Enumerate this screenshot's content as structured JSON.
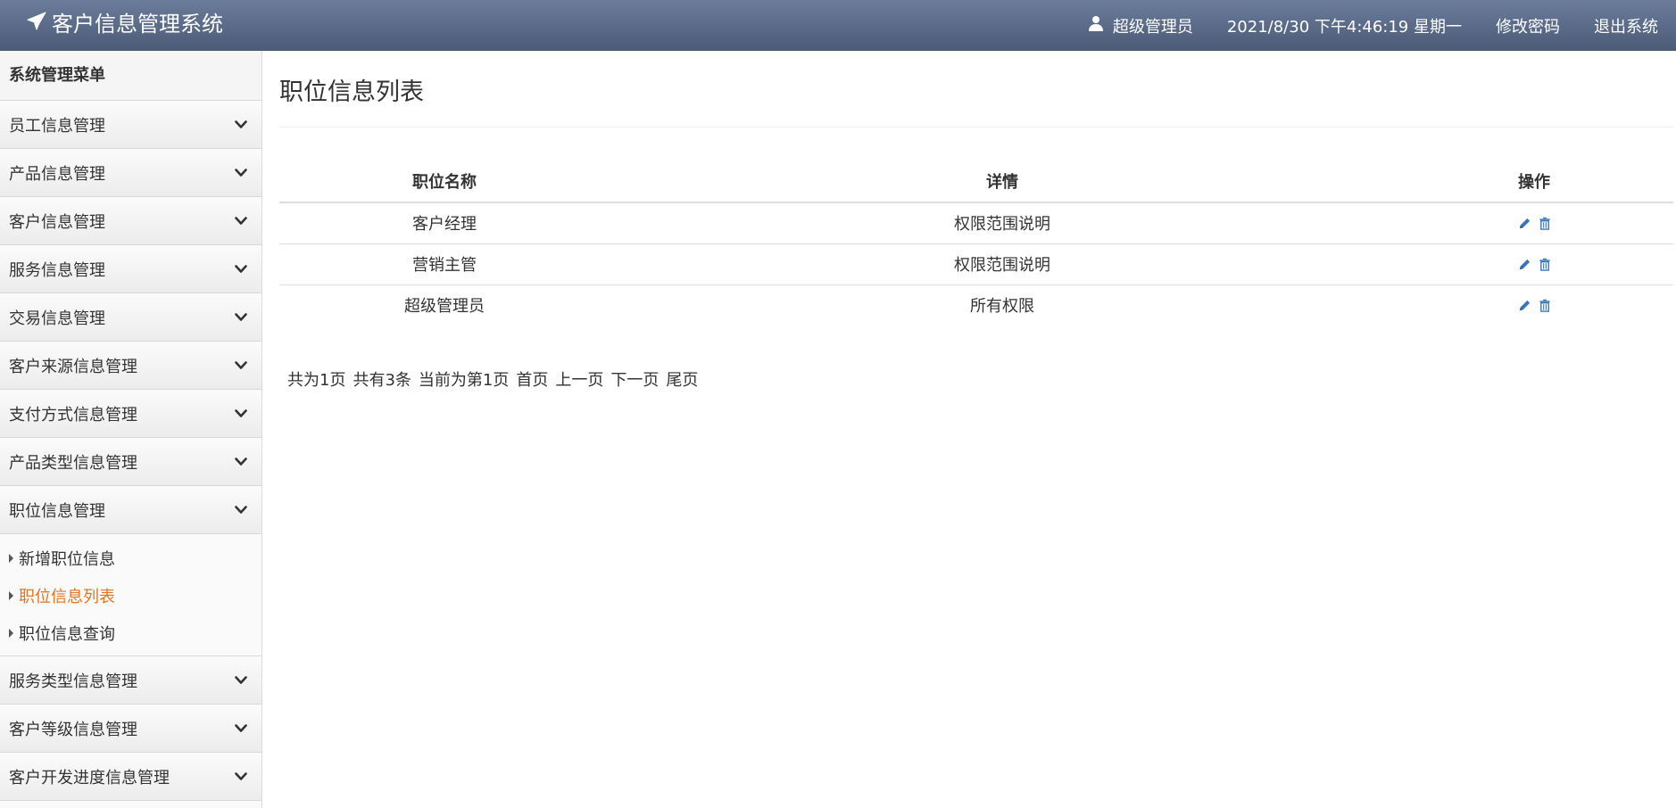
{
  "header": {
    "app_title": "客户信息管理系统",
    "user_name": "超级管理员",
    "datetime": "2021/8/30 下午4:46:19 星期一",
    "change_password": "修改密码",
    "logout": "退出系统"
  },
  "sidebar": {
    "title": "系统管理菜单",
    "items": [
      {
        "label": "员工信息管理"
      },
      {
        "label": "产品信息管理"
      },
      {
        "label": "客户信息管理"
      },
      {
        "label": "服务信息管理"
      },
      {
        "label": "交易信息管理"
      },
      {
        "label": "客户来源信息管理"
      },
      {
        "label": "支付方式信息管理"
      },
      {
        "label": "产品类型信息管理"
      },
      {
        "label": "职位信息管理"
      },
      {
        "label": "服务类型信息管理"
      },
      {
        "label": "客户等级信息管理"
      },
      {
        "label": "客户开发进度信息管理"
      }
    ],
    "expanded_submenu": [
      {
        "label": "新增职位信息"
      },
      {
        "label": "职位信息列表"
      },
      {
        "label": "职位信息查询"
      }
    ],
    "active_color": "#e8731e"
  },
  "main": {
    "page_title": "职位信息列表",
    "table": {
      "headers": [
        "职位名称",
        "详情",
        "操作"
      ],
      "rows": [
        {
          "name": "客户经理",
          "detail": "权限范围说明"
        },
        {
          "name": "营销主管",
          "detail": "权限范围说明"
        },
        {
          "name": "超级管理员",
          "detail": "所有权限"
        }
      ],
      "row_actions": [
        "edit-icon",
        "delete-icon"
      ],
      "icon_color": "#3a75b8"
    },
    "pager": {
      "total_pages": "共为1页",
      "total_count": "共有3条",
      "current": "当前为第1页",
      "first": "首页",
      "prev": "上一页",
      "next": "下一页",
      "last": "尾页"
    }
  }
}
